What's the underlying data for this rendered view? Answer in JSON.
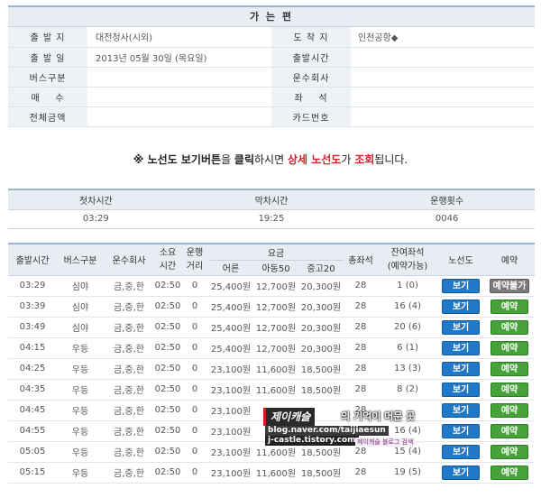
{
  "info": {
    "title": "가 는 편",
    "rows": [
      {
        "l1": "출 발 지",
        "v1": "대전청사(시외)",
        "l2": "도 착 지",
        "v2": "인천공항◆"
      },
      {
        "l1": "출 발 일",
        "v1": "2013년 05월 30일 (목요일)",
        "l2": "출발시간",
        "v2": ""
      },
      {
        "l1": "버스구분",
        "v1": "",
        "l2": "운수회사",
        "v2": ""
      },
      {
        "l1": "매    수",
        "v1": "",
        "l2": "좌    석",
        "v2": ""
      },
      {
        "l1": "전체금액",
        "v1": "",
        "l2": "카드번호",
        "v2": ""
      }
    ]
  },
  "notice": {
    "prefix": "※ ",
    "b1": "노선도 보기버튼",
    "t1": "을 ",
    "b2": "클릭",
    "t2": "하시면 ",
    "r1": "상세 노선도",
    "t3": "가 ",
    "r2": "조회",
    "t4": "됩니다."
  },
  "schedule": {
    "headers": [
      "첫차시간",
      "막차시간",
      "운행횟수"
    ],
    "values": [
      "03:29",
      "19:25",
      "0046"
    ]
  },
  "table": {
    "headers": {
      "depart": "출발시간",
      "bus": "버스구분",
      "company": "운수회사",
      "time": "소요\n시간",
      "dist": "운행\n거리",
      "fare": "요금",
      "adult": "어른",
      "child": "아동50",
      "teen": "중고20",
      "seats": "총좌석",
      "remain": "잔여좌석\n(예약가능)",
      "route": "노선도",
      "reserve": "예약"
    },
    "rows": [
      {
        "depart": "03:29",
        "bus": "심야",
        "company": "금,중,한",
        "time": "02:50",
        "dist": "0",
        "adult": "25,400원",
        "child": "12,700원",
        "teen": "20,300원",
        "seats": "28",
        "remain": "1 (0)",
        "route": "보기",
        "reserve": "예약불가",
        "avail": false
      },
      {
        "depart": "03:39",
        "bus": "심야",
        "company": "금,중,한",
        "time": "02:50",
        "dist": "0",
        "adult": "25,400원",
        "child": "12,700원",
        "teen": "20,300원",
        "seats": "28",
        "remain": "16 (4)",
        "route": "보기",
        "reserve": "예약",
        "avail": true
      },
      {
        "depart": "03:49",
        "bus": "심야",
        "company": "금,중,한",
        "time": "02:50",
        "dist": "0",
        "adult": "25,400원",
        "child": "12,700원",
        "teen": "20,300원",
        "seats": "28",
        "remain": "20 (6)",
        "route": "보기",
        "reserve": "예약",
        "avail": true
      },
      {
        "depart": "04:15",
        "bus": "우등",
        "company": "금,중,한",
        "time": "02:50",
        "dist": "0",
        "adult": "25,400원",
        "child": "12,700원",
        "teen": "20,300원",
        "seats": "28",
        "remain": "6 (1)",
        "route": "보기",
        "reserve": "예약",
        "avail": true
      },
      {
        "depart": "04:25",
        "bus": "우등",
        "company": "금,중,한",
        "time": "02:50",
        "dist": "0",
        "adult": "23,100원",
        "child": "11,600원",
        "teen": "18,500원",
        "seats": "28",
        "remain": "13 (3)",
        "route": "보기",
        "reserve": "예약",
        "avail": true
      },
      {
        "depart": "04:35",
        "bus": "우등",
        "company": "금,중,한",
        "time": "02:50",
        "dist": "0",
        "adult": "23,100원",
        "child": "11,600원",
        "teen": "18,500원",
        "seats": "28",
        "remain": "8 (2)",
        "route": "보기",
        "reserve": "예약",
        "avail": true
      },
      {
        "depart": "04:45",
        "bus": "우등",
        "company": "금,중,한",
        "time": "02:50",
        "dist": "0",
        "adult": "23,100원",
        "child": "",
        "teen": "",
        "seats": "28",
        "remain": "",
        "route": "보기",
        "reserve": "예약",
        "avail": true
      },
      {
        "depart": "04:55",
        "bus": "우등",
        "company": "금,중,한",
        "time": "02:50",
        "dist": "0",
        "adult": "23,100원",
        "child": "",
        "teen": "",
        "seats": "",
        "remain": "16 (4)",
        "route": "보기",
        "reserve": "예약",
        "avail": true
      },
      {
        "depart": "05:05",
        "bus": "우등",
        "company": "금,중,한",
        "time": "02:50",
        "dist": "0",
        "adult": "23,100원",
        "child": "11,600원",
        "teen": "18,500원",
        "seats": "28",
        "remain": "15 (4)",
        "route": "보기",
        "reserve": "예약",
        "avail": true
      },
      {
        "depart": "05:15",
        "bus": "우등",
        "company": "금,중,한",
        "time": "02:50",
        "dist": "0",
        "adult": "23,100원",
        "child": "11,600원",
        "teen": "18,500원",
        "seats": "28",
        "remain": "19 (5)",
        "route": "보기",
        "reserve": "예약",
        "avail": true
      }
    ]
  },
  "watermark": {
    "logo": "제이캐슬",
    "tag": "의 기억이 머문 곳",
    "url1": "blog.naver.com/taijiaesun",
    "url2": "j-castle.tistory.com",
    "small": "제이캐슬 블로그 검색"
  },
  "colors": {
    "accent_blue": "#1f78c8",
    "accent_green": "#47a23a",
    "disabled_gray": "#7a7a7a",
    "notice_red": "#d0202a"
  }
}
